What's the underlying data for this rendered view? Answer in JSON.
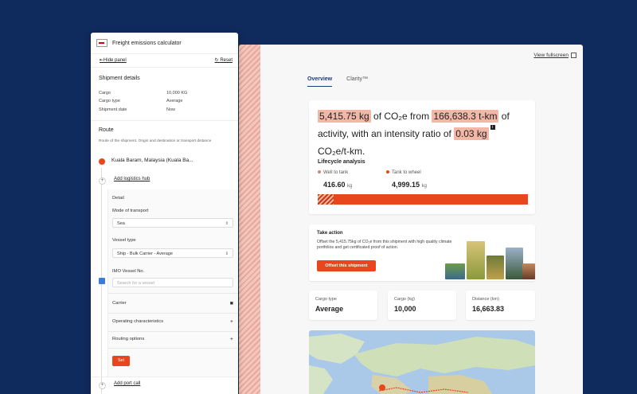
{
  "main": {
    "view_fullscreen": "View fullscreen",
    "tabs": [
      {
        "label": "Overview",
        "active": true
      },
      {
        "label": "Clarity™",
        "active": false
      }
    ],
    "headline": {
      "emissions": "5,415.75 kg",
      "text1": " of CO₂e from ",
      "activity": "166,638.3 t-km",
      "text2": " of activity, with an intensity ratio of ",
      "ratio": "0.03 kg",
      "text3": " CO₂e/t-km."
    },
    "lifecycle": {
      "title": "Lifecycle analysis",
      "well_to_tank_label": "Well to tank",
      "well_to_tank_value": "416.60",
      "tank_to_wheel_label": "Tank to wheel",
      "tank_to_wheel_value": "4,999.15",
      "unit": "kg",
      "well_to_tank_fraction": 0.077
    },
    "offset": {
      "title": "Take action",
      "description": "Offset the 5,415.75kg of CO₂e from this shipment with high quality climate portfolios and get certificated proof of action.",
      "button": "Offset this shipment"
    },
    "stats": [
      {
        "label": "Cargo type",
        "value": "Average"
      },
      {
        "label": "Cargo (kg)",
        "value": "10,000"
      },
      {
        "label": "Distance (km)",
        "value": "16,663.83"
      }
    ]
  },
  "sidebar": {
    "title": "Freight emissions calculator",
    "hide_panel": "Hide panel",
    "reset": "Reset",
    "shipment_title": "Shipment details",
    "shipment": [
      {
        "key": "Cargo",
        "value": "10,000 KG"
      },
      {
        "key": "Cargo type",
        "value": "Average"
      },
      {
        "key": "Shipment date",
        "value": "Now"
      }
    ],
    "route_title": "Route",
    "route_desc": "Route of the shipment. Origin and destination or transport distance",
    "origin": "Kuala Baram, Malaysia (Kuala Ba...",
    "add_logistics_hub": "Add logistics hub",
    "detail_label": "Detail",
    "mode_label": "Mode of transport",
    "mode_value": "Sea",
    "vessel_type_label": "Vessel type",
    "vessel_type_value": "Ship - Bulk Carrier - Average",
    "imo_label": "IMO Vessel No.",
    "imo_placeholder": "Search for a vessel",
    "carrier_label": "Carrier",
    "operating_label": "Operating characteristics",
    "routing_label": "Routing options",
    "set_button": "Set",
    "add_port_call": "Add port call"
  }
}
